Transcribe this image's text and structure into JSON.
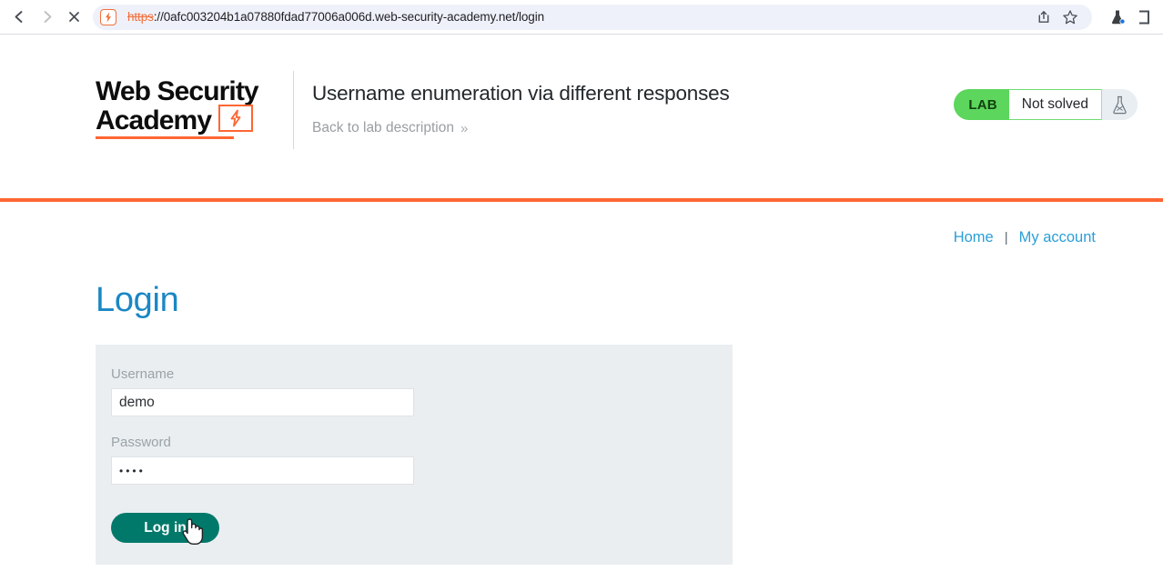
{
  "browser": {
    "back_icon": "back-arrow-icon",
    "forward_icon": "forward-arrow-icon",
    "stop_icon": "stop-x-icon",
    "site_badge_icon": "not-secure-lightning-icon",
    "url_scheme": "https",
    "url_rest": "://0afc003204b1a07880fdad77006a006d.web-security-academy.net/login",
    "url_full": "https://0afc003204b1a07880fdad77006a006d.web-security-academy.net/login",
    "share_icon": "share-icon",
    "bookmark_icon": "star-bookmark-icon",
    "extension_icon": "burp-suite-flask-extension-icon",
    "overflow_icon": "extensions-puzzle-icon"
  },
  "header": {
    "logo_line1": "Web Security",
    "logo_line2": "Academy",
    "logo_bolt_icon": "lightning-bolt-icon",
    "lab_title": "Username enumeration via different responses",
    "back_link": "Back to lab description",
    "back_link_chevron": "double-chevron-right-icon",
    "status": {
      "badge": "LAB",
      "state": "Not solved",
      "flask_icon": "lab-flask-icon",
      "badge_color": "#5cd65c"
    },
    "accent_color": "#ff6633"
  },
  "site_nav": {
    "home": "Home",
    "separator": "|",
    "my_account": "My account",
    "link_color": "#2a9fd6"
  },
  "login": {
    "heading": "Login",
    "username_label": "Username",
    "username_value": "demo",
    "username_placeholder": "",
    "password_label": "Password",
    "password_value": "••••",
    "password_placeholder": "",
    "submit_label": "Log in",
    "submit_color": "#00796b",
    "panel_color": "#eaeef1"
  },
  "cursor": {
    "type": "pointing-hand-cursor"
  }
}
